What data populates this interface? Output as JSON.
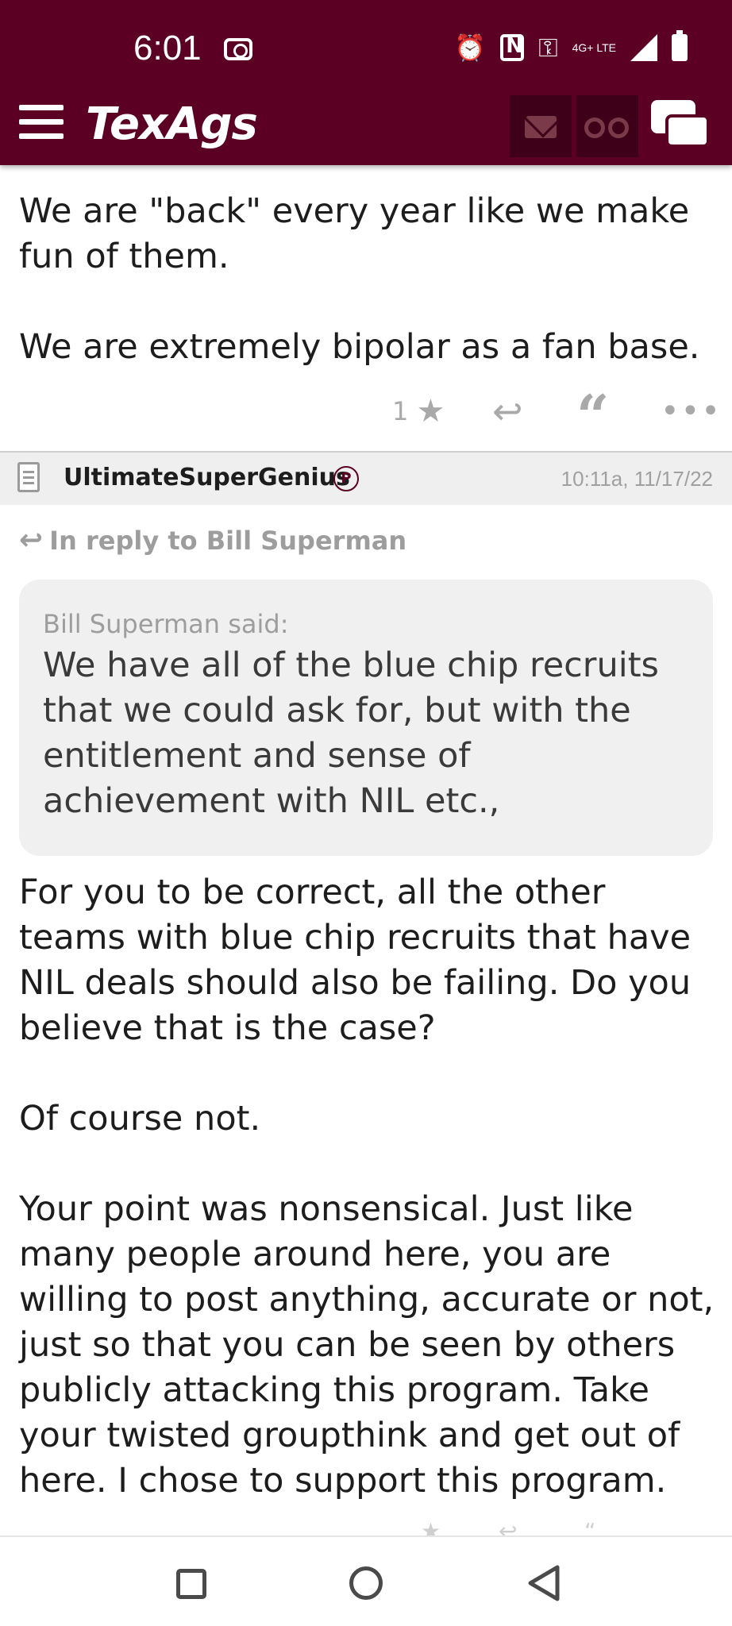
{
  "status_bar": {
    "time": "6:01",
    "network": "4G+ LTE",
    "icons": [
      "camera-icon",
      "alarm-icon",
      "nfc-icon",
      "key-icon",
      "signal-icon",
      "battery-icon"
    ]
  },
  "app_bar": {
    "logo": "TexAgs",
    "icons": [
      "menu-icon",
      "mail-icon",
      "binoculars-icon",
      "chat-icon"
    ],
    "colors": {
      "brand": "#5c0023",
      "button_bg": "#3d0018"
    }
  },
  "previous_post": {
    "paragraphs": [
      "We are \"back\" every year like we make fun of them.",
      "We are extremely bipolar as a fan base."
    ],
    "actions": {
      "rating_count": "1"
    }
  },
  "post": {
    "username": "UltimateSuperGenius",
    "badge": "P",
    "timestamp": "10:11a, 11/17/22",
    "in_reply_to": "In reply to Bill Superman",
    "quote": {
      "author": "Bill Superman said:",
      "text": "We have all of the blue chip recruits that we could ask for, but with the entitlement and sense of achievement with NIL etc.,"
    },
    "paragraphs": [
      "For you to be correct, all the other teams with blue chip recruits that have NIL deals should also be failing. Do you believe that is the case?",
      "Of course not.",
      "Your point was nonsensical. Just like many people around here, you are willing to post anything, accurate or not, just so that you can be seen by others publicly attacking this program. Take your twisted groupthink and get out of here. I chose to support this program."
    ]
  },
  "nav_bar": {
    "buttons": [
      "recents-button",
      "home-button",
      "back-button"
    ]
  }
}
